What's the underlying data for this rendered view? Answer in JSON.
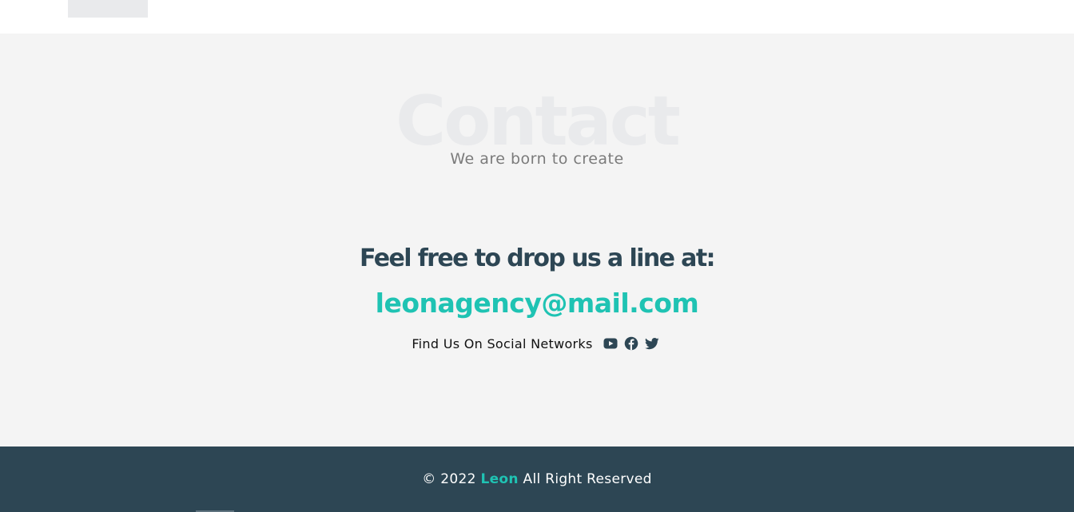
{
  "contact": {
    "bg_title": "Contact",
    "subtitle": "We are born to create",
    "heading": "Feel free to drop us a line at:",
    "email": "leonagency@mail.com",
    "social_label": "Find Us On Social Networks",
    "social_icons": [
      "youtube-icon",
      "facebook-icon",
      "twitter-icon"
    ]
  },
  "footer": {
    "copyright_prefix": "© 2022",
    "brand": "Leon",
    "copyright_suffix": "All Right Reserved"
  },
  "colors": {
    "dark": "#2d4654",
    "accent": "#1fc3b3",
    "section_bg": "#f4f4f4",
    "watermark": "#e9eaec"
  }
}
